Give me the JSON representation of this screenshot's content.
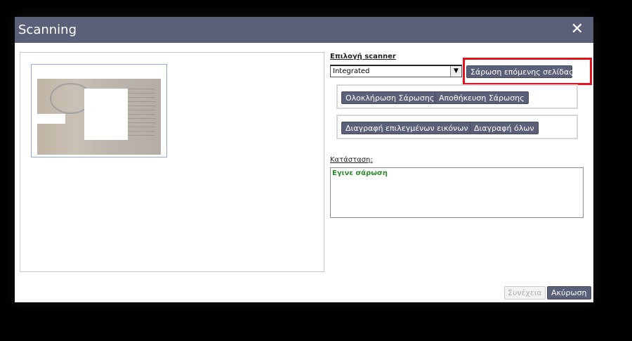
{
  "dialog": {
    "title": "Scanning",
    "close_icon": "close-icon"
  },
  "preview": {
    "thumbnail_label": "scanned-page-thumbnail"
  },
  "scanner": {
    "label": "Επιλογή scanner",
    "selected": "Integrated",
    "scan_next_label": "Σάρωση επόμενης σελίδας"
  },
  "scan_actions": {
    "complete_label": "Ολοκλήρωση Σάρωσης",
    "save_label": "Αποθήκευση Σάρωσης"
  },
  "delete_actions": {
    "delete_selected_label": "Διαγραφή επιλεγμένων εικόνων",
    "delete_all_label": "Διαγραφή όλων"
  },
  "status": {
    "label": "Κατάσταση:",
    "text": "Εγινε σάρωση"
  },
  "footer": {
    "continue_label": "Συνέχεια",
    "cancel_label": "Ακύρωση"
  },
  "colors": {
    "titlebar": "#5b6079",
    "highlight": "#e0141e",
    "status_text": "#2b8a2b"
  }
}
